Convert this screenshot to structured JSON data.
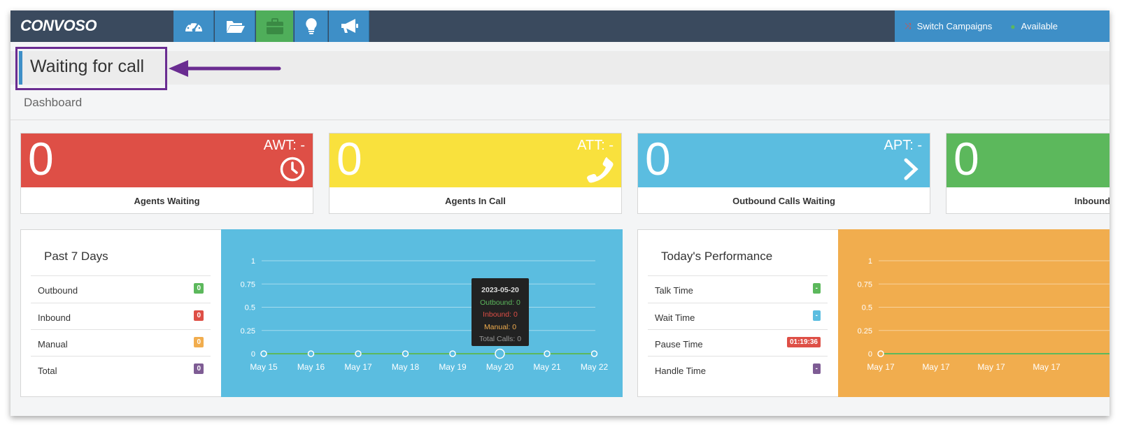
{
  "app": {
    "logo": "CONVOSO"
  },
  "nav": {
    "buttons": [
      {
        "icon": "speedometer-icon"
      },
      {
        "icon": "folder-open-icon"
      },
      {
        "icon": "briefcase-icon"
      },
      {
        "icon": "lightbulb-icon"
      },
      {
        "icon": "megaphone-icon"
      }
    ],
    "switch_campaigns": "Switch Campaigns",
    "available": "Available"
  },
  "status": {
    "text": "Waiting for call"
  },
  "breadcrumb": "Dashboard",
  "colors": {
    "red": "#de4f46",
    "yellow": "#f9e13d",
    "blue": "#5bbde0",
    "green": "#5cb85c",
    "orange": "#f1ad4e",
    "purple": "#6a2c91",
    "topbar": "#3a4a5e",
    "nav_blue": "#3e8fc7"
  },
  "cards": [
    {
      "value": "0",
      "metric": "AWT: -",
      "icon": "clock-icon",
      "label": "Agents Waiting"
    },
    {
      "value": "0",
      "metric": "ATT: -",
      "icon": "phone-icon",
      "label": "Agents In Call"
    },
    {
      "value": "0",
      "metric": "APT: -",
      "icon": "chevron-right-icon",
      "label": "Outbound Calls Waiting"
    },
    {
      "value": "0",
      "metric": "",
      "icon": "",
      "label": "Inbound"
    }
  ],
  "past7": {
    "title": "Past 7 Days",
    "rows": [
      {
        "label": "Outbound",
        "value": "0"
      },
      {
        "label": "Inbound",
        "value": "0"
      },
      {
        "label": "Manual",
        "value": "0"
      },
      {
        "label": "Total",
        "value": "0"
      }
    ]
  },
  "today": {
    "title": "Today's Performance",
    "rows": [
      {
        "label": "Talk Time",
        "value": "-"
      },
      {
        "label": "Wait Time",
        "value": "-"
      },
      {
        "label": "Pause Time",
        "value": "01:19:36"
      },
      {
        "label": "Handle Time",
        "value": "-"
      }
    ]
  },
  "tooltip": {
    "date": "2023-05-20",
    "outbound": "Outbound: 0",
    "inbound": "Inbound: 0",
    "manual": "Manual: 0",
    "total": "Total Calls: 0"
  },
  "chart_data": [
    {
      "type": "line",
      "x": [
        "May 15",
        "May 16",
        "May 17",
        "May 18",
        "May 19",
        "May 20",
        "May 21",
        "May 22"
      ],
      "series": [
        {
          "values": [
            0,
            0,
            0,
            0,
            0,
            0,
            0,
            0
          ]
        }
      ],
      "y_ticks": [
        "0",
        "0.25",
        "0.5",
        "0.75",
        "1"
      ],
      "ylim": [
        0,
        1
      ],
      "highlight_index": 5,
      "grid": true
    },
    {
      "type": "line",
      "x": [
        "May 17",
        "May 17",
        "May 17",
        "May 17"
      ],
      "series": [
        {
          "values": [
            0
          ]
        }
      ],
      "y_ticks": [
        "0",
        "0.25",
        "0.5",
        "0.75",
        "1"
      ],
      "ylim": [
        0,
        1
      ],
      "grid": true
    }
  ]
}
